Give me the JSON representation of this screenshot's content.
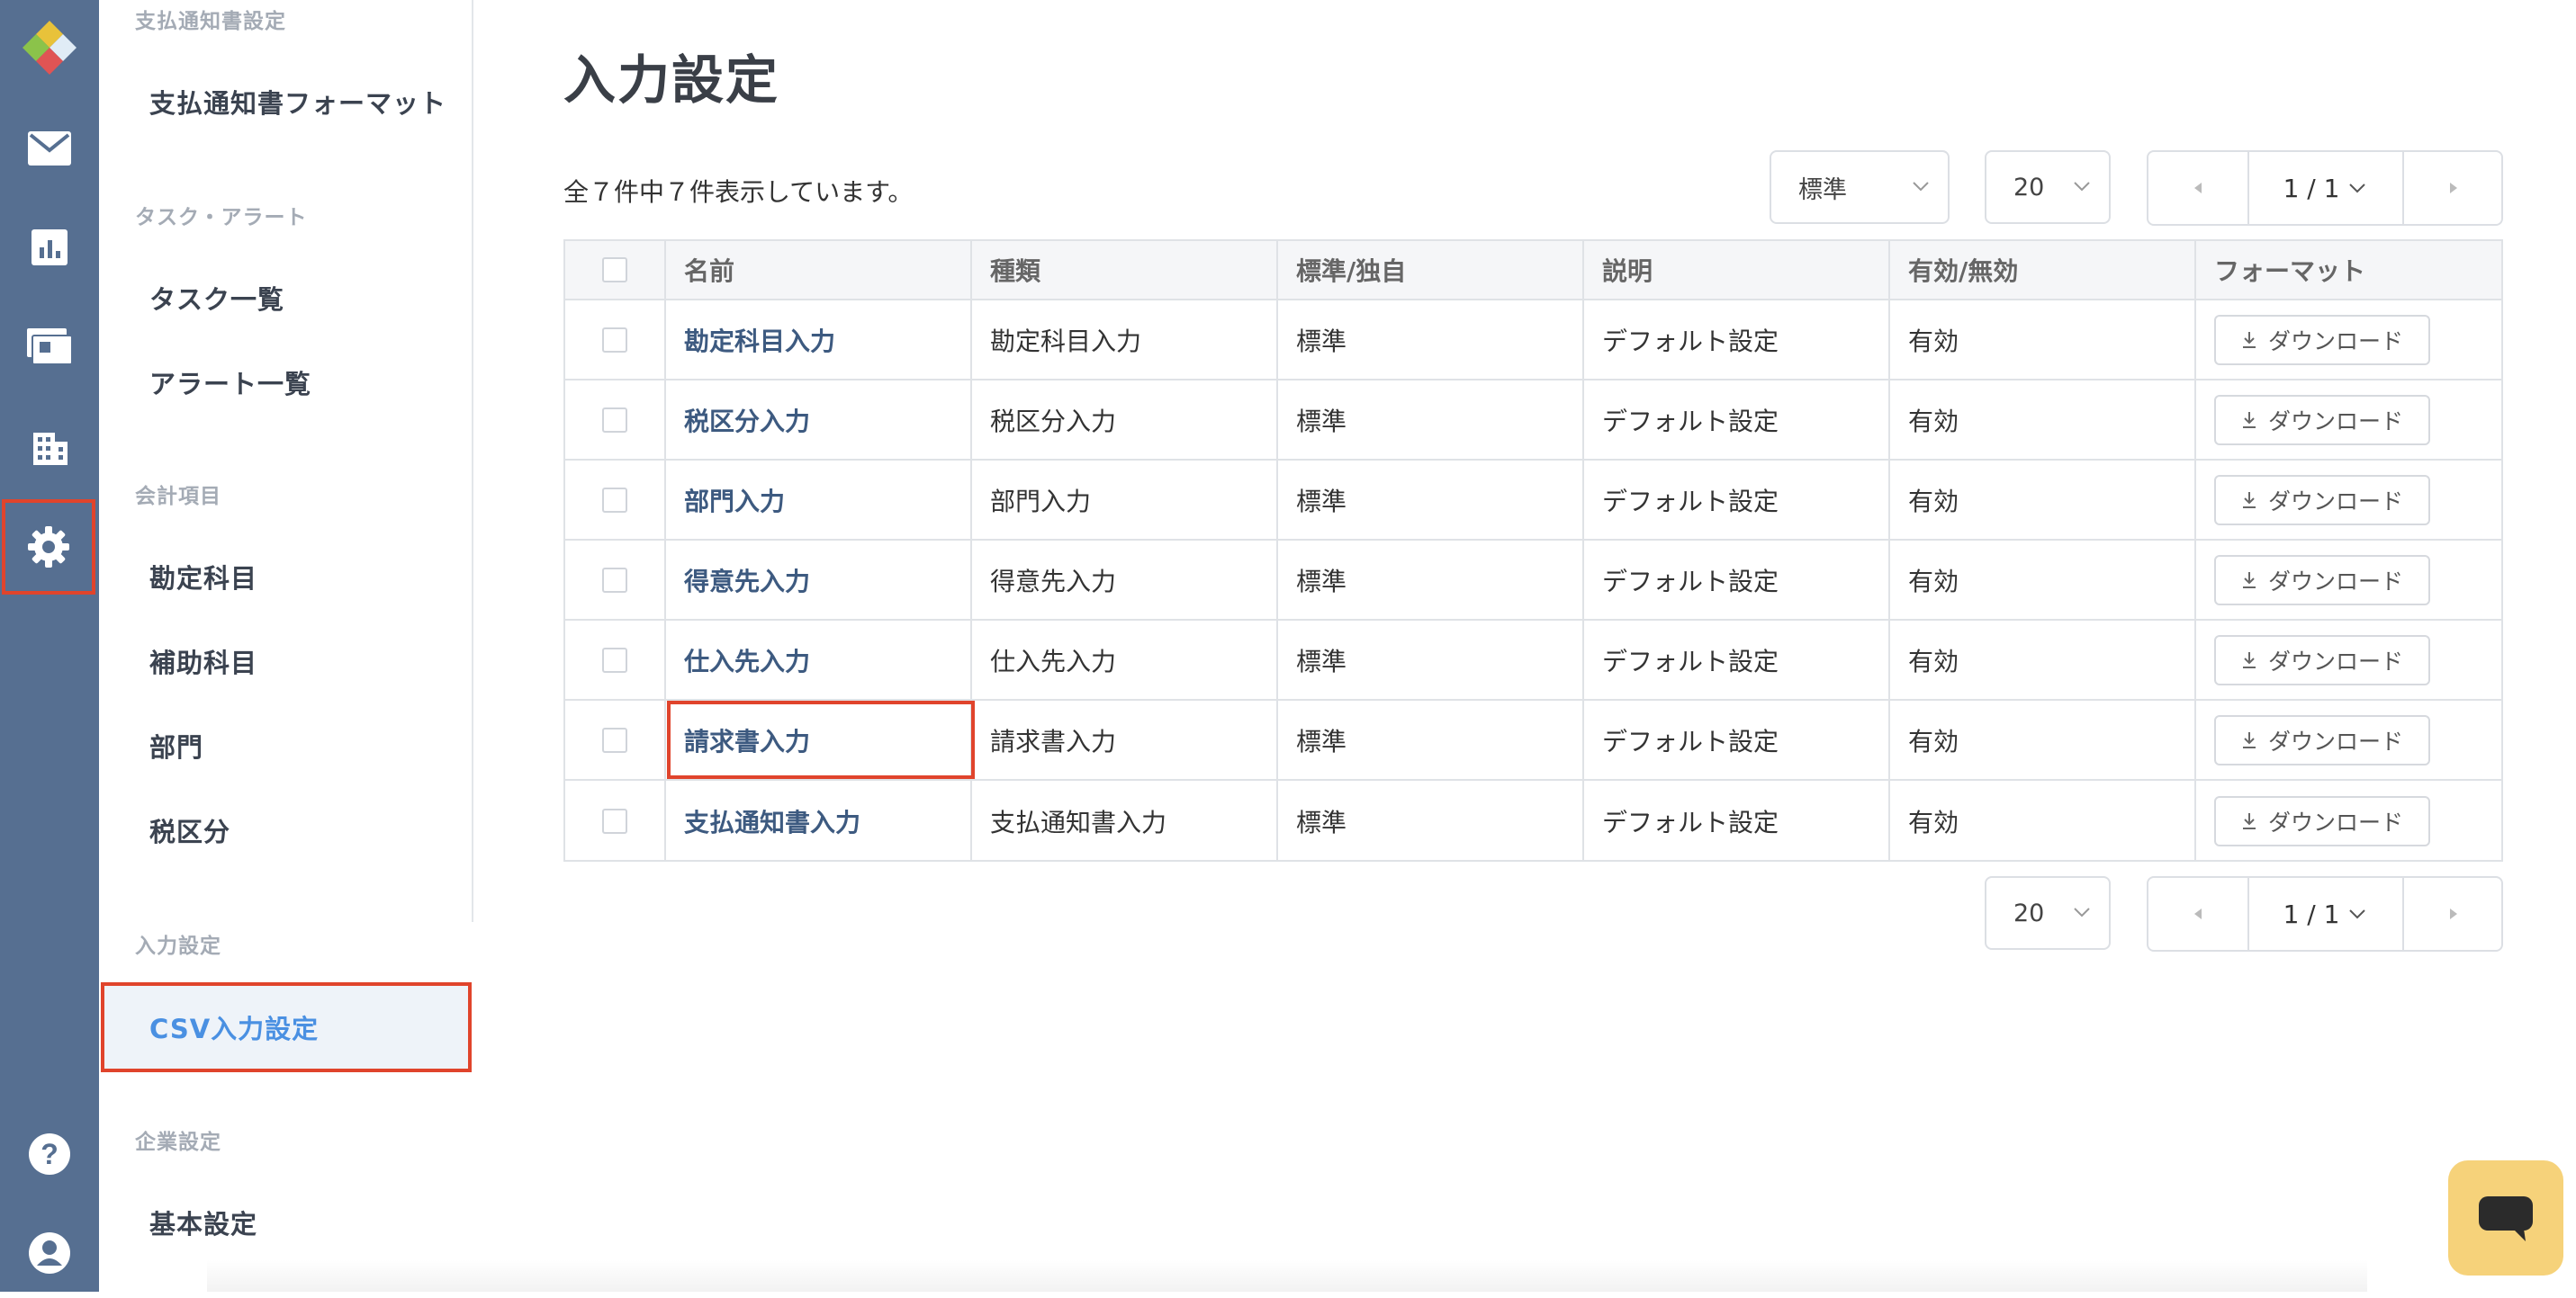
{
  "sidebar": {
    "sections": [
      {
        "title": "支払通知書設定",
        "items": [
          "支払通知書フォーマット"
        ]
      },
      {
        "title": "タスク・アラート",
        "items": [
          "タスク一覧",
          "アラート一覧"
        ]
      },
      {
        "title": "会計項目",
        "items": [
          "勘定科目",
          "補助科目",
          "部門",
          "税区分"
        ]
      },
      {
        "title": "入力設定",
        "items": [
          "CSV入力設定"
        ]
      },
      {
        "title": "企業設定",
        "items": [
          "基本設定"
        ]
      }
    ]
  },
  "rail": {
    "icons": [
      "logo-icon",
      "mail-icon",
      "report-icon",
      "money-icon",
      "building-icon",
      "gear-icon",
      "help-icon",
      "account-icon"
    ],
    "accent": "#566f91",
    "highlight": "#e0442c"
  },
  "main": {
    "title": "入力設定",
    "count_text": "全７件中７件表示しています。",
    "filter_select": "標準",
    "per_page": "20",
    "page_indicator": "1 / 1",
    "table": {
      "headers": [
        "名前",
        "種類",
        "標準/独自",
        "説明",
        "有効/無効",
        "フォーマット"
      ],
      "rows": [
        {
          "name": "勘定科目入力",
          "type": "勘定科目入力",
          "std": "標準",
          "desc": "デフォルト設定",
          "status": "有効",
          "action": "ダウンロード"
        },
        {
          "name": "税区分入力",
          "type": "税区分入力",
          "std": "標準",
          "desc": "デフォルト設定",
          "status": "有効",
          "action": "ダウンロード"
        },
        {
          "name": "部門入力",
          "type": "部門入力",
          "std": "標準",
          "desc": "デフォルト設定",
          "status": "有効",
          "action": "ダウンロード"
        },
        {
          "name": "得意先入力",
          "type": "得意先入力",
          "std": "標準",
          "desc": "デフォルト設定",
          "status": "有効",
          "action": "ダウンロード"
        },
        {
          "name": "仕入先入力",
          "type": "仕入先入力",
          "std": "標準",
          "desc": "デフォルト設定",
          "status": "有効",
          "action": "ダウンロード"
        },
        {
          "name": "請求書入力",
          "type": "請求書入力",
          "std": "標準",
          "desc": "デフォルト設定",
          "status": "有効",
          "action": "ダウンロード"
        },
        {
          "name": "支払通知書入力",
          "type": "支払通知書入力",
          "std": "標準",
          "desc": "デフォルト設定",
          "status": "有効",
          "action": "ダウンロード"
        }
      ]
    },
    "link_color": "#3d5a80"
  },
  "chat_icon": "chat-icon"
}
